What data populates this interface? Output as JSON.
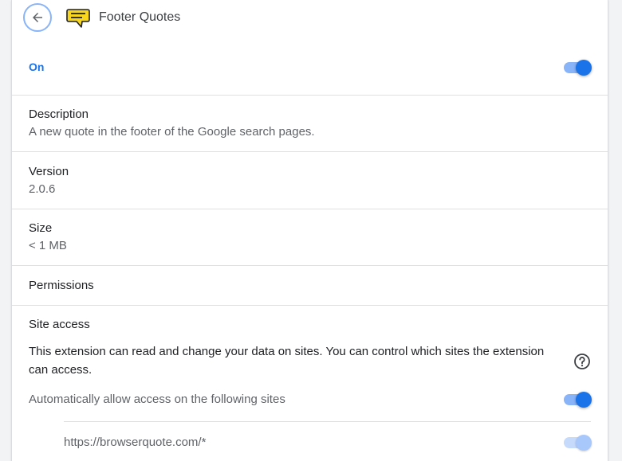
{
  "extension": {
    "name": "Footer Quotes",
    "enabled_label": "On",
    "enabled": true
  },
  "details": {
    "description_label": "Description",
    "description_value": "A new quote in the footer of the Google search pages.",
    "version_label": "Version",
    "version_value": "2.0.6",
    "size_label": "Size",
    "size_value": "< 1 MB",
    "permissions_label": "Permissions"
  },
  "site_access": {
    "title": "Site access",
    "description": "This extension can read and change your data on sites. You can control which sites the extension can access.",
    "auto_allow_label": "Automatically allow access on the following sites",
    "auto_allow_enabled": true,
    "sites": [
      {
        "url": "https://browserquote.com/*",
        "enabled": true
      }
    ]
  },
  "colors": {
    "accent": "#1a73e8",
    "toggle_track": "#8ab4f8",
    "icon_yellow": "#f9d71c"
  },
  "icons": {
    "back": "arrow-back-icon",
    "extension": "speech-bubble-icon",
    "help": "help-circle-icon"
  }
}
